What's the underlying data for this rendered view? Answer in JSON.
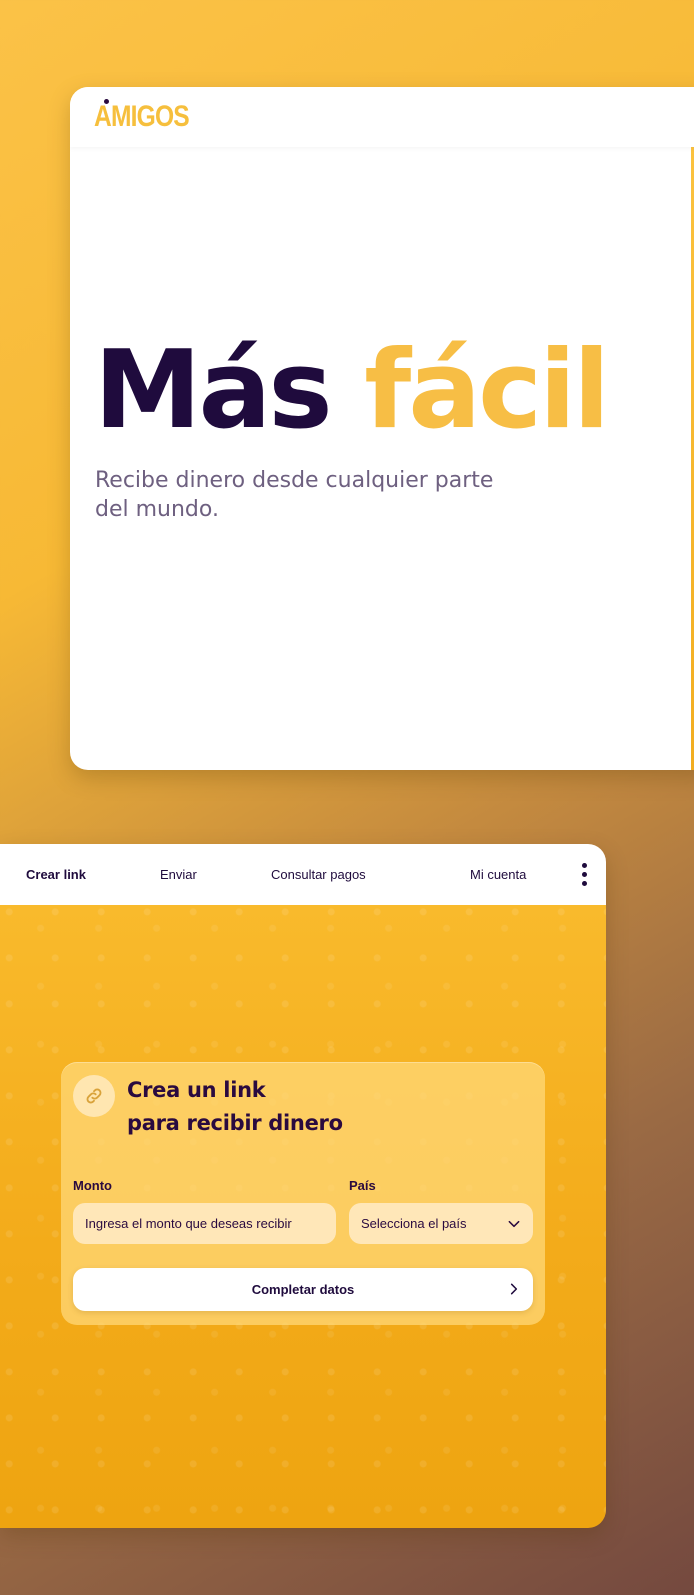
{
  "brand": {
    "logo_text": "AMIGOS"
  },
  "hero": {
    "title_part1": "Más",
    "title_part2": "fácil",
    "subtitle": "Recibe dinero desde cualquier parte del mundo."
  },
  "nav": {
    "items": [
      {
        "label": "Crear link",
        "active": true
      },
      {
        "label": "Enviar",
        "active": false
      },
      {
        "label": "Consultar pagos",
        "active": false
      },
      {
        "label": "Mi cuenta",
        "active": false
      }
    ],
    "more_icon": "kebab-menu-icon"
  },
  "form": {
    "icon": "link-icon",
    "title_line1": "Crea un link",
    "title_line2": "para recibir dinero",
    "amount_label": "Monto",
    "amount_placeholder": "Ingresa el monto que deseas recibir",
    "country_label": "País",
    "country_placeholder": "Selecciona el país",
    "submit_label": "Completar datos"
  },
  "colors": {
    "brand_yellow": "#f7be45",
    "deep_purple": "#1f0b3d",
    "subtitle_gray": "#6e6080"
  }
}
